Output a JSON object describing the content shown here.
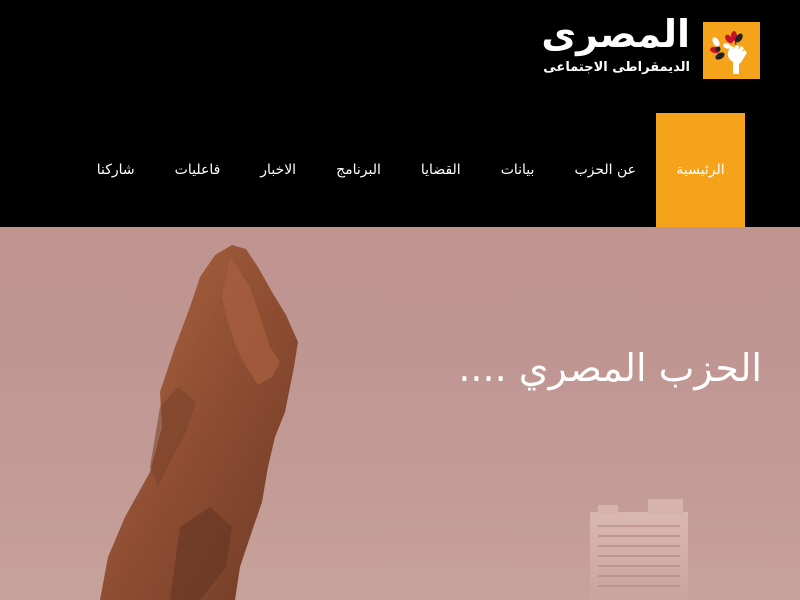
{
  "logo": {
    "name": "المصرى",
    "subtitle": "الديمقراطى الاجتماعى",
    "emblem_icon": "raised-fist-flower-icon",
    "accent_color": "#f5a31a"
  },
  "nav": {
    "items": [
      {
        "label": "الرئيسية",
        "active": true
      },
      {
        "label": "عن الحزب",
        "active": false
      },
      {
        "label": "بيانات",
        "active": false
      },
      {
        "label": "القضايا",
        "active": false
      },
      {
        "label": "البرنامج",
        "active": false
      },
      {
        "label": "الاخبار",
        "active": false
      },
      {
        "label": "فاعليات",
        "active": false
      },
      {
        "label": "شاركنا",
        "active": false
      }
    ]
  },
  "hero": {
    "title": "الحزب المصري ....",
    "image_subject": "lion-statue-and-tower"
  }
}
